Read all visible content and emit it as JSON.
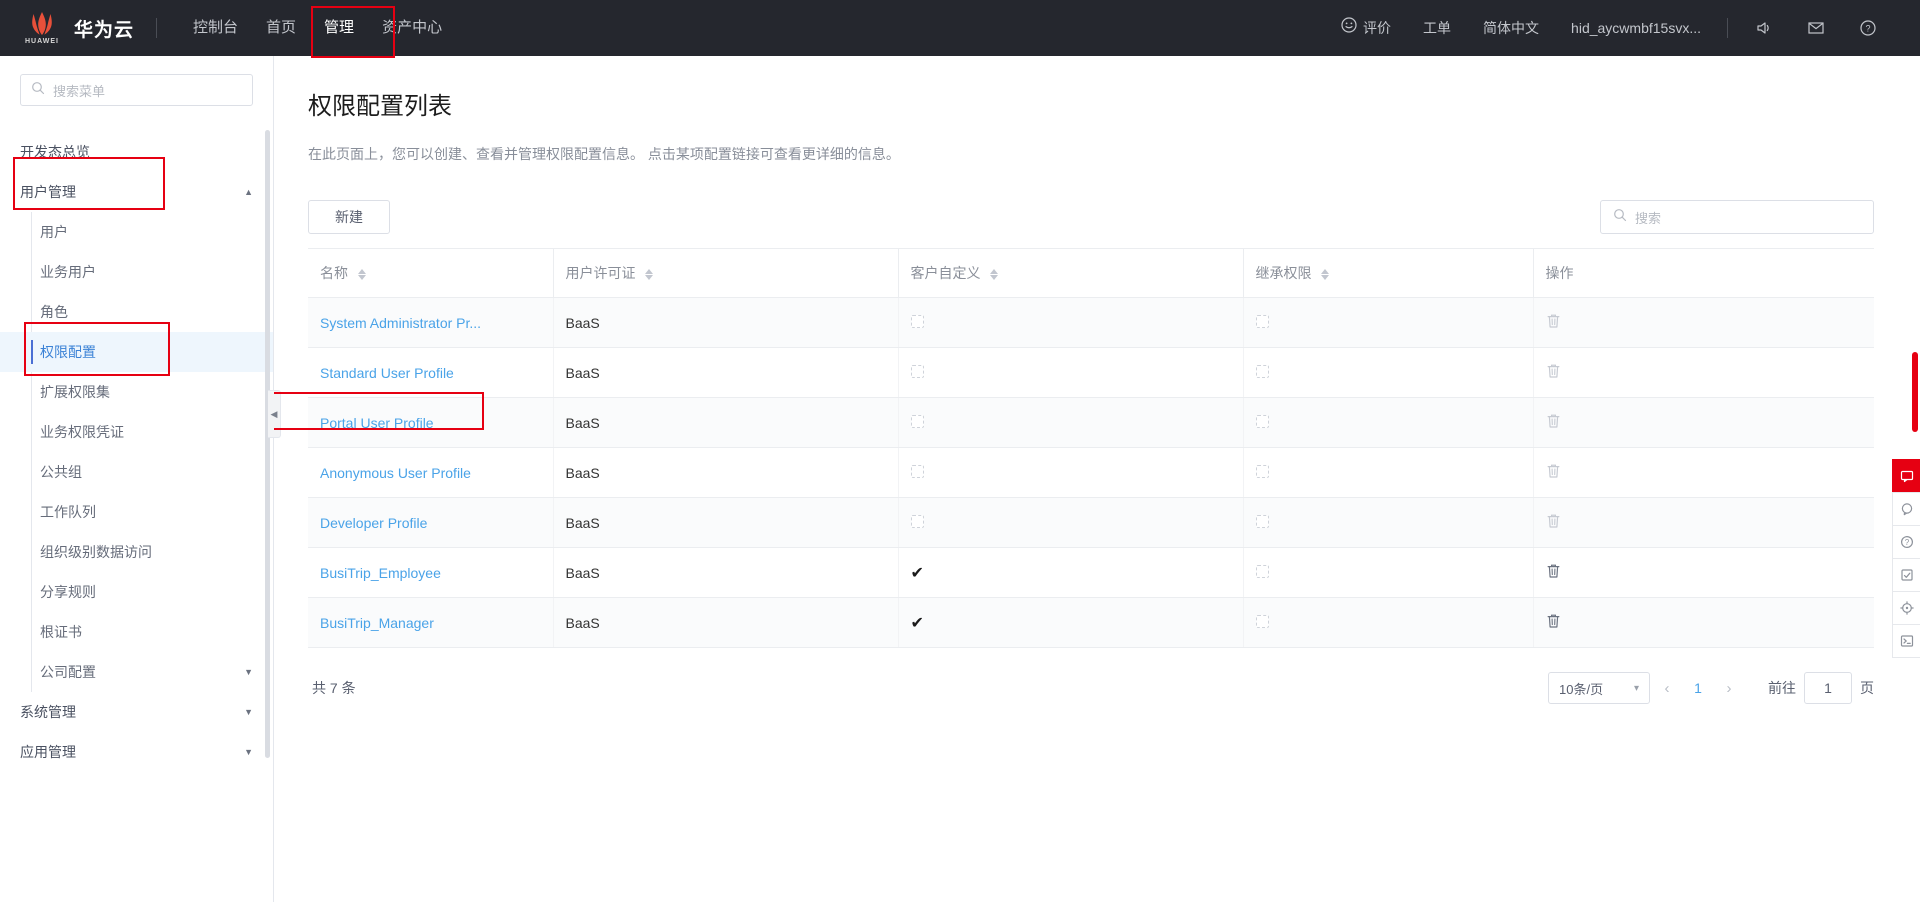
{
  "header": {
    "brand": "华为云",
    "brand_sub": "HUAWEI",
    "nav": [
      {
        "label": "控制台",
        "active": false
      },
      {
        "label": "首页",
        "active": false
      },
      {
        "label": "管理",
        "active": true
      },
      {
        "label": "资产中心",
        "active": false
      }
    ],
    "right": [
      {
        "label": "评价",
        "icon": "smiley-icon"
      },
      {
        "label": "工单",
        "icon": ""
      },
      {
        "label": "简体中文",
        "icon": ""
      },
      {
        "label": "hid_aycwmbf15svx...",
        "icon": ""
      }
    ],
    "icons": {
      "speaker": "speaker-icon",
      "mail": "mail-icon",
      "help": "help-icon"
    },
    "highlight_color": "#e60012"
  },
  "sidebar": {
    "search_placeholder": "搜索菜单",
    "items": [
      {
        "label": "开发态总览",
        "type": "group",
        "caret": ""
      },
      {
        "label": "用户管理",
        "type": "group",
        "caret": "▲",
        "highlighted": true
      },
      {
        "label": "用户",
        "type": "sub"
      },
      {
        "label": "业务用户",
        "type": "sub"
      },
      {
        "label": "角色",
        "type": "sub"
      },
      {
        "label": "权限配置",
        "type": "sub",
        "active": true,
        "highlighted": true
      },
      {
        "label": "扩展权限集",
        "type": "sub"
      },
      {
        "label": "业务权限凭证",
        "type": "sub"
      },
      {
        "label": "公共组",
        "type": "sub"
      },
      {
        "label": "工作队列",
        "type": "sub"
      },
      {
        "label": "组织级别数据访问",
        "type": "sub"
      },
      {
        "label": "分享规则",
        "type": "sub"
      },
      {
        "label": "根证书",
        "type": "sub"
      },
      {
        "label": "公司配置",
        "type": "sub",
        "caret": "▼"
      },
      {
        "label": "系统管理",
        "type": "group",
        "caret": "▼"
      },
      {
        "label": "应用管理",
        "type": "group",
        "caret": "▼"
      }
    ],
    "collapse_glyph": "◀"
  },
  "main": {
    "title": "权限配置列表",
    "description": "在此页面上，您可以创建、查看并管理权限配置信息。 点击某项配置链接可查看更详细的信息。",
    "new_button": "新建",
    "search_placeholder": "搜索"
  },
  "table": {
    "columns": [
      {
        "label": "名称",
        "sortable": true
      },
      {
        "label": "用户许可证",
        "sortable": true
      },
      {
        "label": "客户自定义",
        "sortable": true
      },
      {
        "label": "继承权限",
        "sortable": true
      },
      {
        "label": "操作",
        "sortable": false
      }
    ],
    "rows": [
      {
        "name": "System Administrator Pr...",
        "license": "BaaS",
        "custom": false,
        "inherit": false,
        "delete_enabled": false,
        "highlighted": false
      },
      {
        "name": "Standard User Profile",
        "license": "BaaS",
        "custom": false,
        "inherit": false,
        "delete_enabled": false,
        "highlighted": false
      },
      {
        "name": "Portal User Profile",
        "license": "BaaS",
        "custom": false,
        "inherit": false,
        "delete_enabled": false,
        "highlighted": true
      },
      {
        "name": "Anonymous User Profile",
        "license": "BaaS",
        "custom": false,
        "inherit": false,
        "delete_enabled": false,
        "highlighted": false
      },
      {
        "name": "Developer Profile",
        "license": "BaaS",
        "custom": false,
        "inherit": false,
        "delete_enabled": false,
        "highlighted": false
      },
      {
        "name": "BusiTrip_Employee",
        "license": "BaaS",
        "custom": true,
        "inherit": false,
        "delete_enabled": true,
        "highlighted": false
      },
      {
        "name": "BusiTrip_Manager",
        "license": "BaaS",
        "custom": true,
        "inherit": false,
        "delete_enabled": true,
        "highlighted": false
      }
    ],
    "check_glyph": "✔",
    "trash_glyph": "trash-icon"
  },
  "footer": {
    "total": "共 7 条",
    "page_size": "10条/页",
    "prev": "‹",
    "next": "›",
    "current_page": "1",
    "goto_label": "前往",
    "goto_value": "1",
    "page_unit": "页"
  },
  "rail": [
    {
      "icon": "feedback-icon",
      "glyph": "▤",
      "accent": true
    },
    {
      "icon": "chat-icon",
      "glyph": "◍",
      "accent": false
    },
    {
      "icon": "help-icon",
      "glyph": "?",
      "accent": false
    },
    {
      "icon": "edit-icon",
      "glyph": "✎",
      "accent": false
    },
    {
      "icon": "location-icon",
      "glyph": "◎",
      "accent": false
    },
    {
      "icon": "terminal-icon",
      "glyph": "›_",
      "accent": false
    }
  ]
}
